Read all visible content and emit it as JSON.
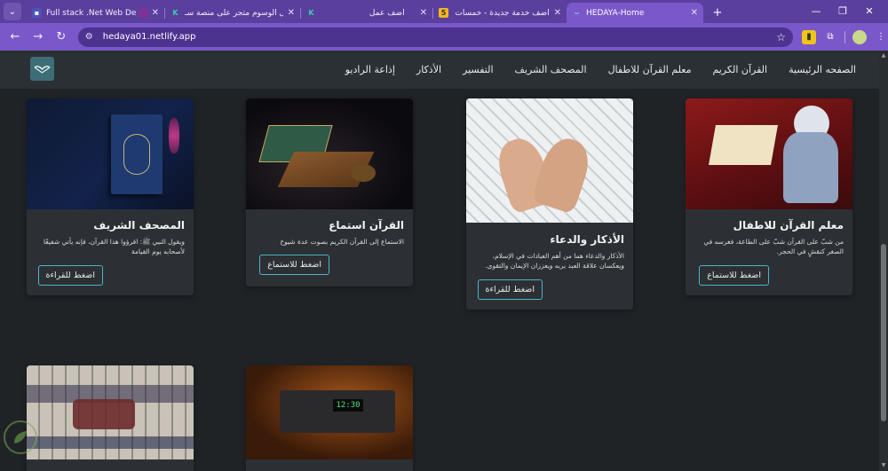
{
  "browser": {
    "tabs": [
      {
        "label": "Full stack .Net Web Develop",
        "icon": "chat-icon",
        "active": false
      },
      {
        "label": "ادخال الوسوم متجر على منصة سـ",
        "icon": "k-icon",
        "active": false
      },
      {
        "label": "أضف عمل",
        "icon": "k-icon",
        "active": false
      },
      {
        "label": "أضف خدمة جديدة - خمسات",
        "icon": "khamsat-icon",
        "active": false
      },
      {
        "label": "HEDAYA-Home",
        "icon": "hedaya-icon",
        "active": true
      }
    ],
    "url": "hedaya01.netlify.app",
    "new_tab": "+"
  },
  "nav": {
    "links": [
      "الصفحه الرئيسية",
      "القرآن الكريم",
      "معلم القرآن للاطفال",
      "المصحف الشريف",
      "التفسير",
      "الأذكار",
      "إذاعة الراديو"
    ]
  },
  "cards": [
    {
      "title": "المصحف الشريف",
      "text": "ويقول النبي ﷺ: اقرؤوا هذا القرآن، فإنه يأتي شفيعًا لأصحابه يوم القيامة",
      "button": "اضغط للقراءة"
    },
    {
      "title": "القرآن استماع",
      "text": "الاستماع إلى القرآن الكريم بصوت عدة شيوخ",
      "button": "اضغط للاستماع"
    },
    {
      "title": "الأذكار والدعاء",
      "text": "الأذكار والدعاء هما من أهم العبادات في الإسلام، ويعكسان علاقة العبد بربه ويعززان الإيمان والتقوى.",
      "button": "اضغط للقراءة"
    },
    {
      "title": "معلم القرآن للاطفال",
      "text": "من شبّ على القرآن شبّ على الطاعة، فغرسه في الصغر كنقشٍ في الحجر.",
      "button": "اضغط للاستماع"
    }
  ],
  "radio_display": "12:30",
  "colors": {
    "page_bg": "#202326",
    "card_bg": "#2c3035",
    "nav_bg": "#2b3035",
    "button_border": "#4ab5c9",
    "browser_frame": "#7a58c9"
  }
}
